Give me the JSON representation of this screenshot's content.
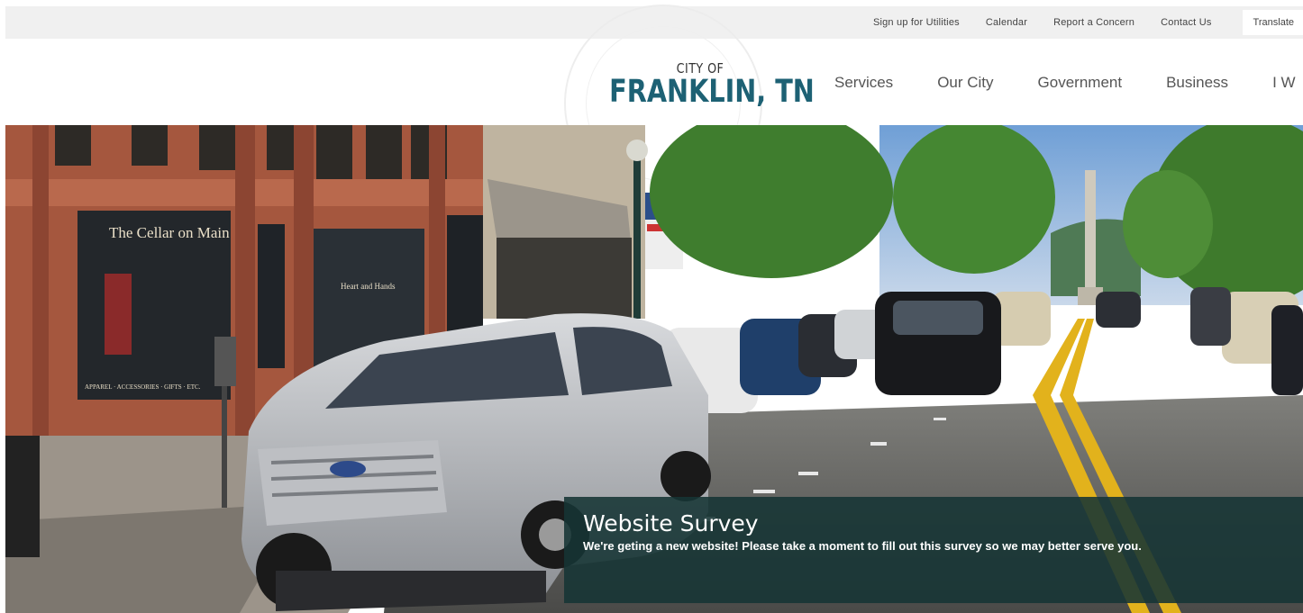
{
  "utility_nav": {
    "links": [
      "Sign up for Utilities",
      "Calendar",
      "Report a Concern",
      "Contact Us"
    ],
    "translate_label": "Translate"
  },
  "logo": {
    "line1": "CITY OF",
    "line2": "FRANKLIN, TN",
    "color": "#1d6174"
  },
  "main_nav": {
    "items": [
      "Services",
      "Our City",
      "Government",
      "Business",
      "I W"
    ]
  },
  "hero": {
    "storefront_sign": "The Cellar on Main",
    "storefront_sub": "APPAREL · ACCESSORIES · GIFTS · ETC.",
    "shop_sign": "Heart and Hands"
  },
  "survey": {
    "title": "Website Survey",
    "text": "We're geting a new website! Please take a moment to fill out this survey so we may better serve you."
  }
}
